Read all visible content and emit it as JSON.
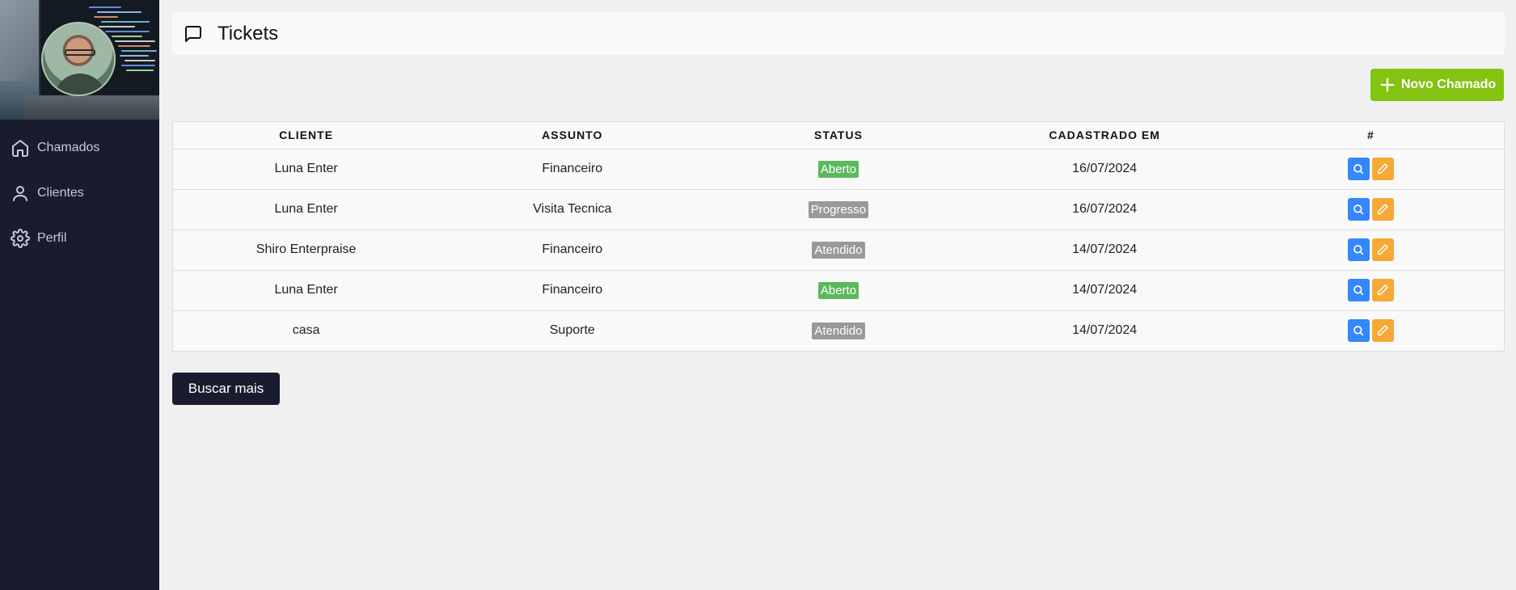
{
  "sidebar": {
    "items": [
      {
        "label": "Chamados",
        "icon": "home-icon"
      },
      {
        "label": "Clientes",
        "icon": "user-icon"
      },
      {
        "label": "Perfil",
        "icon": "settings-icon"
      }
    ]
  },
  "header": {
    "title": "Tickets",
    "icon": "message-square-icon"
  },
  "toolbar": {
    "new_label": "Novo Chamado"
  },
  "table": {
    "columns": [
      "Cliente",
      "Assunto",
      "Status",
      "Cadastrado em",
      "#"
    ],
    "rows": [
      {
        "cliente": "Luna Enter",
        "assunto": "Financeiro",
        "status": "Aberto",
        "status_color": "#5cb85c",
        "cadastrado": "16/07/2024"
      },
      {
        "cliente": "Luna Enter",
        "assunto": "Visita Tecnica",
        "status": "Progresso",
        "status_color": "#999999",
        "cadastrado": "16/07/2024"
      },
      {
        "cliente": "Shiro Enterpraise",
        "assunto": "Financeiro",
        "status": "Atendido",
        "status_color": "#999999",
        "cadastrado": "14/07/2024"
      },
      {
        "cliente": "Luna Enter",
        "assunto": "Financeiro",
        "status": "Aberto",
        "status_color": "#5cb85c",
        "cadastrado": "14/07/2024"
      },
      {
        "cliente": "casa",
        "assunto": "Suporte",
        "status": "Atendido",
        "status_color": "#999999",
        "cadastrado": "14/07/2024"
      }
    ]
  },
  "footer": {
    "more_label": "Buscar mais"
  },
  "colors": {
    "sidebar_bg": "#181c2e",
    "accent_green": "#83c312",
    "view_button": "#3586ff",
    "edit_button": "#f6a935"
  }
}
